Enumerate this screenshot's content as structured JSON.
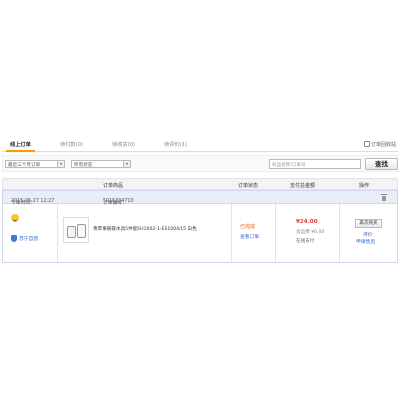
{
  "tabs": [
    {
      "label": "线上订单"
    },
    {
      "label": "待付款(0)"
    },
    {
      "label": "待收货(0)"
    },
    {
      "label": "待评价(1)"
    }
  ],
  "recycle_label": "订单回收站",
  "filters": {
    "time_range": "最近三个月订单",
    "status": "所有状态",
    "search_placeholder": "商品名称/订单号",
    "search_button": "查找"
  },
  "columns": [
    "订单商品",
    "订单状态",
    "支付总金额",
    "操作"
  ],
  "order": {
    "time_label": "下单时间：",
    "time": "2015-05-27 12:27",
    "number_label": "订单编号：",
    "number": "5016334710",
    "shop": "苏宁自营",
    "product_name": "青苹果碗碟水具5件套EH1002-1-ES1004/L5 白色",
    "status": "已完成",
    "view_link": "查看订单",
    "price": "¥24.00",
    "shipping": "含运费 ¥0.00",
    "payment": "在线支付",
    "rebuy_button": "再次购买",
    "review_link": "评价",
    "repair_link": "申请售后"
  },
  "colors": {
    "accent": "#ff9900",
    "price": "#e4393c",
    "status": "#e45b10",
    "link": "#3366cc",
    "order_header_bg": "#e8eef8"
  }
}
